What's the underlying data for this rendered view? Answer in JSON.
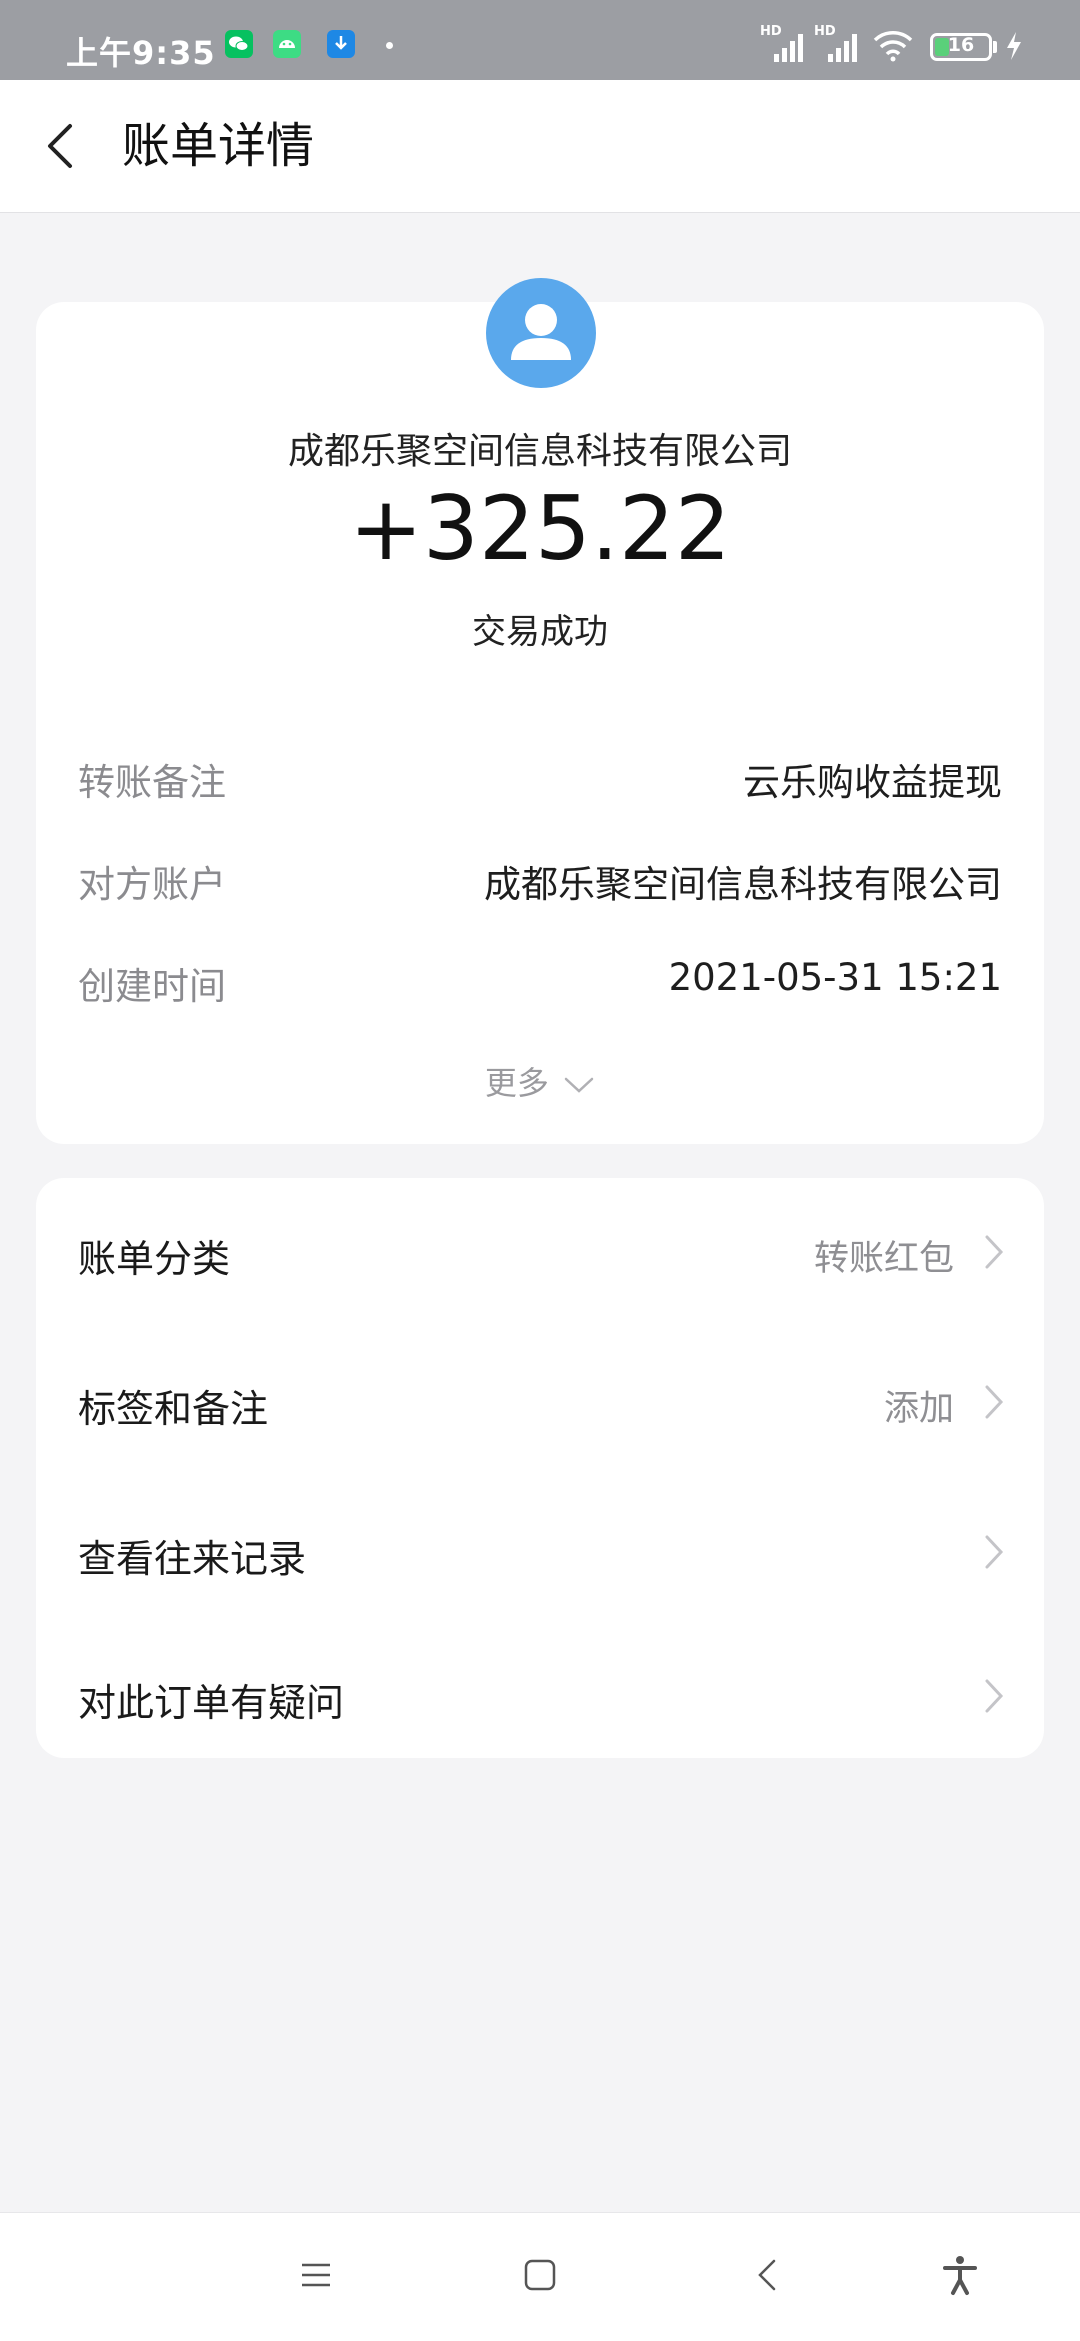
{
  "status_bar": {
    "time": "上午9:35",
    "signal_1_label": "HD",
    "signal_2_label": "HD",
    "battery_level": "16",
    "battery_fraction": 0.16,
    "notification_icons": [
      "wechat-icon",
      "android-icon",
      "download-icon"
    ]
  },
  "header": {
    "title": "账单详情",
    "back_icon": "chevron-left-icon"
  },
  "summary": {
    "counterparty": "成都乐聚空间信息科技有限公司",
    "amount": "+325.22",
    "status": "交易成功",
    "avatar_color": "#5aa8ec",
    "details": [
      {
        "label": "转账备注",
        "value": "云乐购收益提现"
      },
      {
        "label": "对方账户",
        "value": "成都乐聚空间信息科技有限公司"
      },
      {
        "label": "创建时间",
        "value": "2021-05-31 15:21"
      }
    ],
    "more_label": "更多"
  },
  "options": [
    {
      "label": "账单分类",
      "value": "转账红包"
    },
    {
      "label": "标签和备注",
      "value": "添加"
    },
    {
      "label": "查看往来记录",
      "value": ""
    },
    {
      "label": "对此订单有疑问",
      "value": ""
    }
  ],
  "nav_bar": {
    "icons": [
      "menu-icon",
      "home-icon",
      "back-icon",
      "accessibility-icon"
    ]
  }
}
